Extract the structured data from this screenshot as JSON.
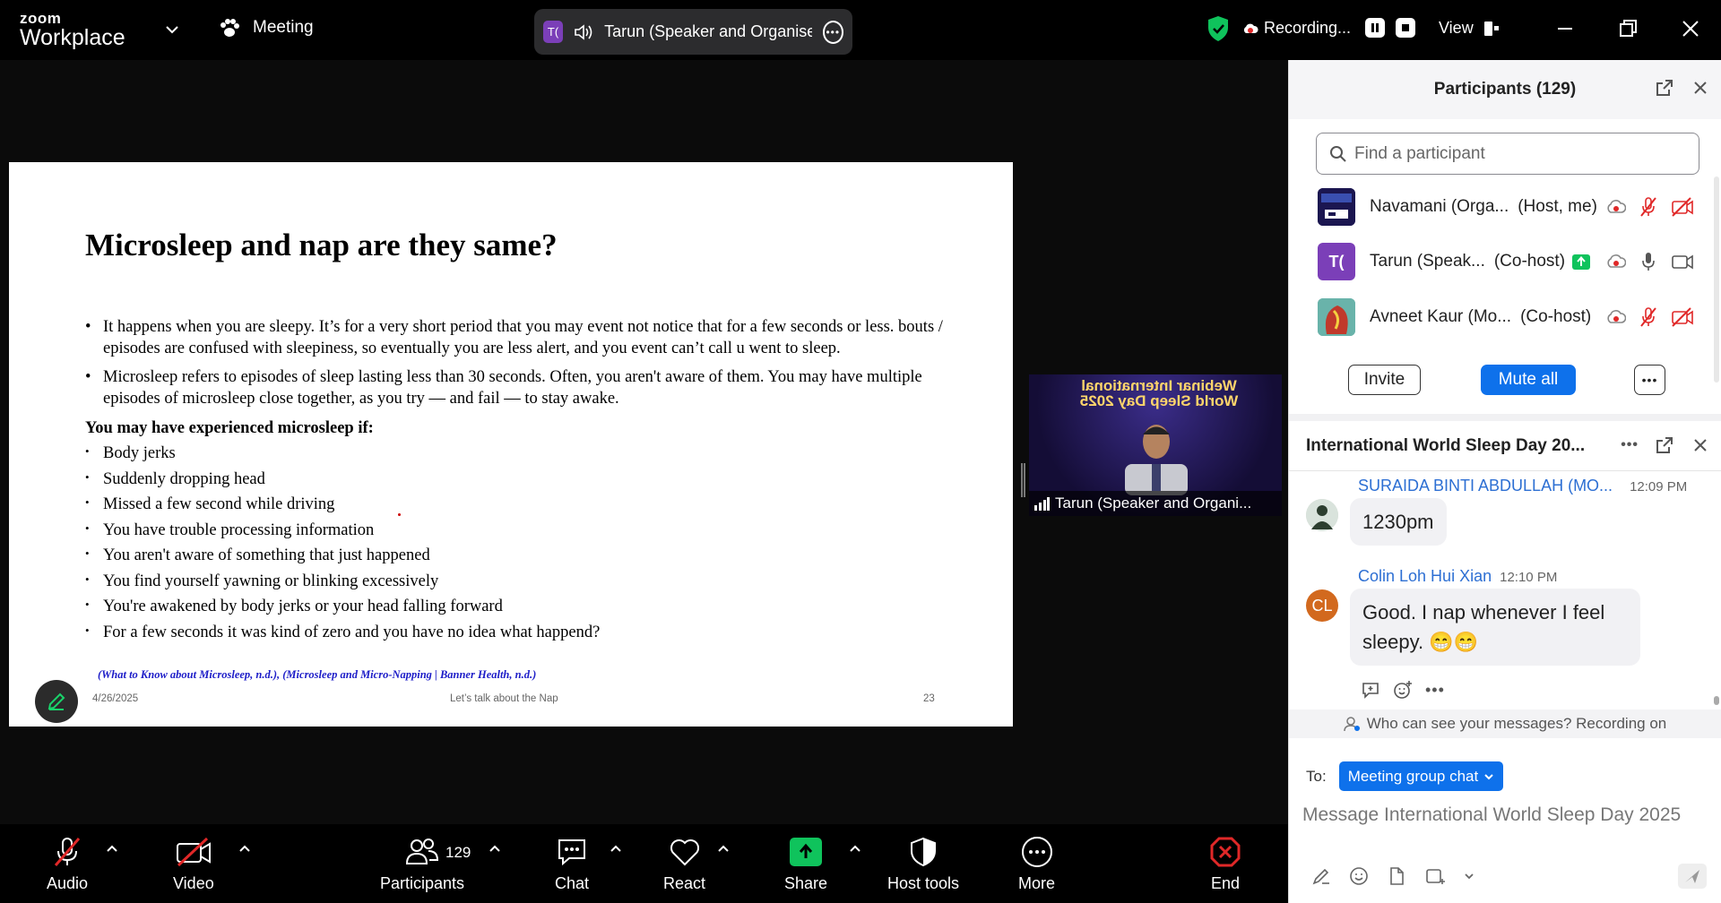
{
  "topbar": {
    "logo_small": "zoom",
    "logo_big": "Workplace",
    "meeting_label": "Meeting",
    "speaker_initials": "T(",
    "speaker_name": "Tarun (Speaker and Organiser",
    "recording_label": "Recording...",
    "view_label": "View"
  },
  "slide": {
    "title": "Microsleep and nap are they same?",
    "bullets": [
      "It happens when you are sleepy.  It’s for a very short period that you may event not notice that for a few seconds or less. bouts / episodes are confused with sleepiness, so eventually you are less alert, and you event can’t call u went to sleep.",
      "Microsleep refers to episodes of sleep lasting less than 30 seconds. Often, you aren't aware of them. You may have multiple episodes of microsleep close together, as you try — and fail — to stay awake."
    ],
    "experienced_heading": "You may have experienced microsleep if:",
    "experienced_items": [
      "Body jerks",
      "Suddenly dropping head",
      "Missed a few second while driving",
      "You have trouble processing information",
      "You aren't aware of something that just happened",
      "You find yourself yawning or blinking excessively",
      "You're awakened by body jerks or your head falling forward",
      "For a few seconds it was kind of zero  and you have no idea what happend?"
    ],
    "references": "(What to Know about Microsleep, n.d.), (Microsleep and Micro-Napping | Banner Health, n.d.)",
    "footer_date": "4/26/2025",
    "footer_title": "Let’s talk about the Nap",
    "footer_page": "23"
  },
  "video": {
    "banner": "Webinar International World Sleep Day 2025",
    "name_label": "Tarun (Speaker and Organi..."
  },
  "toolbar": {
    "audio": "Audio",
    "video": "Video",
    "participants": "Participants",
    "participants_count": "129",
    "chat": "Chat",
    "react": "React",
    "share": "Share",
    "host_tools": "Host tools",
    "more": "More",
    "end": "End"
  },
  "participants_panel": {
    "title": "Participants (129)",
    "search_placeholder": "Find a participant",
    "rows": [
      {
        "name": "Navamani (Orga...",
        "role": "(Host, me)"
      },
      {
        "name": "Tarun (Speak...",
        "role": "(Co-host)",
        "initials": "T("
      },
      {
        "name": "Avneet Kaur (Mo...",
        "role": "(Co-host)"
      }
    ],
    "invite_label": "Invite",
    "mute_all_label": "Mute all"
  },
  "chat_panel": {
    "title": "International World Sleep Day 20...",
    "messages": [
      {
        "sender": "SURAIDA BINTI ABDULLAH (MO...",
        "time": "12:09 PM",
        "text": "1230pm"
      },
      {
        "sender": "Colin Loh Hui Xian",
        "time": "12:10 PM",
        "text": "Good. I nap whenever I feel sleepy. 😁😁",
        "initials": "CL"
      }
    ],
    "visibility_note": "Who can see your messages? Recording on",
    "to_label": "To:",
    "recipient": "Meeting group chat",
    "input_placeholder": "Message International World Sleep Day 2025"
  },
  "colors": {
    "accent_blue": "#0e71eb",
    "share_green": "#0fc35c",
    "end_red": "#e02828",
    "tarun_purple": "#7b3fb8",
    "cl_orange": "#d2691e"
  }
}
